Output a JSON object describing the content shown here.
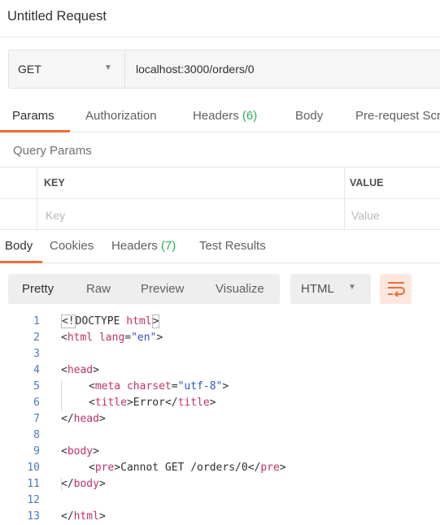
{
  "request": {
    "title": "Untitled Request",
    "method": "GET",
    "url": "localhost:3000/orders/0"
  },
  "request_tabs": {
    "params": "Params",
    "authorization": "Authorization",
    "headers": "Headers",
    "headers_count": "(6)",
    "body": "Body",
    "prerequest": "Pre-request Scr"
  },
  "query_params": {
    "label": "Query Params",
    "key_header": "KEY",
    "value_header": "VALUE",
    "key_placeholder": "Key",
    "value_placeholder": "Value"
  },
  "response_tabs": {
    "body": "Body",
    "cookies": "Cookies",
    "headers": "Headers",
    "headers_count": "(7)",
    "test_results": "Test Results"
  },
  "view_modes": {
    "pretty": "Pretty",
    "raw": "Raw",
    "preview": "Preview",
    "visualize": "Visualize"
  },
  "format": "HTML",
  "accent_color": "#f26b3a",
  "count_color": "#26b35a",
  "code": {
    "line_numbers": [
      "1",
      "2",
      "3",
      "4",
      "5",
      "6",
      "7",
      "8",
      "9",
      "10",
      "11",
      "12",
      "13"
    ],
    "l1": {
      "open": "<!",
      "doctype": "DOCTYPE",
      "sp": " ",
      "html": "html",
      "close": ">"
    },
    "l2": {
      "open": "<",
      "tag": "html",
      "sp": " ",
      "attr": "lang",
      "eq": "=",
      "val": "\"en\"",
      "close": ">"
    },
    "l4": {
      "open": "<",
      "tag": "head",
      "close": ">"
    },
    "l5": {
      "open": "<",
      "tag": "meta",
      "sp": " ",
      "attr": "charset",
      "eq": "=",
      "val": "\"utf-8\"",
      "close": ">"
    },
    "l6": {
      "open": "<",
      "tag": "title",
      "close": ">",
      "text": "Error",
      "open2": "</",
      "tag2": "title",
      "close2": ">"
    },
    "l7": {
      "open": "</",
      "tag": "head",
      "close": ">"
    },
    "l9": {
      "open": "<",
      "tag": "body",
      "close": ">"
    },
    "l10": {
      "open": "<",
      "tag": "pre",
      "close": ">",
      "text": "Cannot GET /orders/0",
      "open2": "</",
      "tag2": "pre",
      "close2": ">"
    },
    "l11": {
      "open": "</",
      "tag": "body",
      "close": ">"
    },
    "l13": {
      "open": "</",
      "tag": "html",
      "close": ">"
    }
  }
}
